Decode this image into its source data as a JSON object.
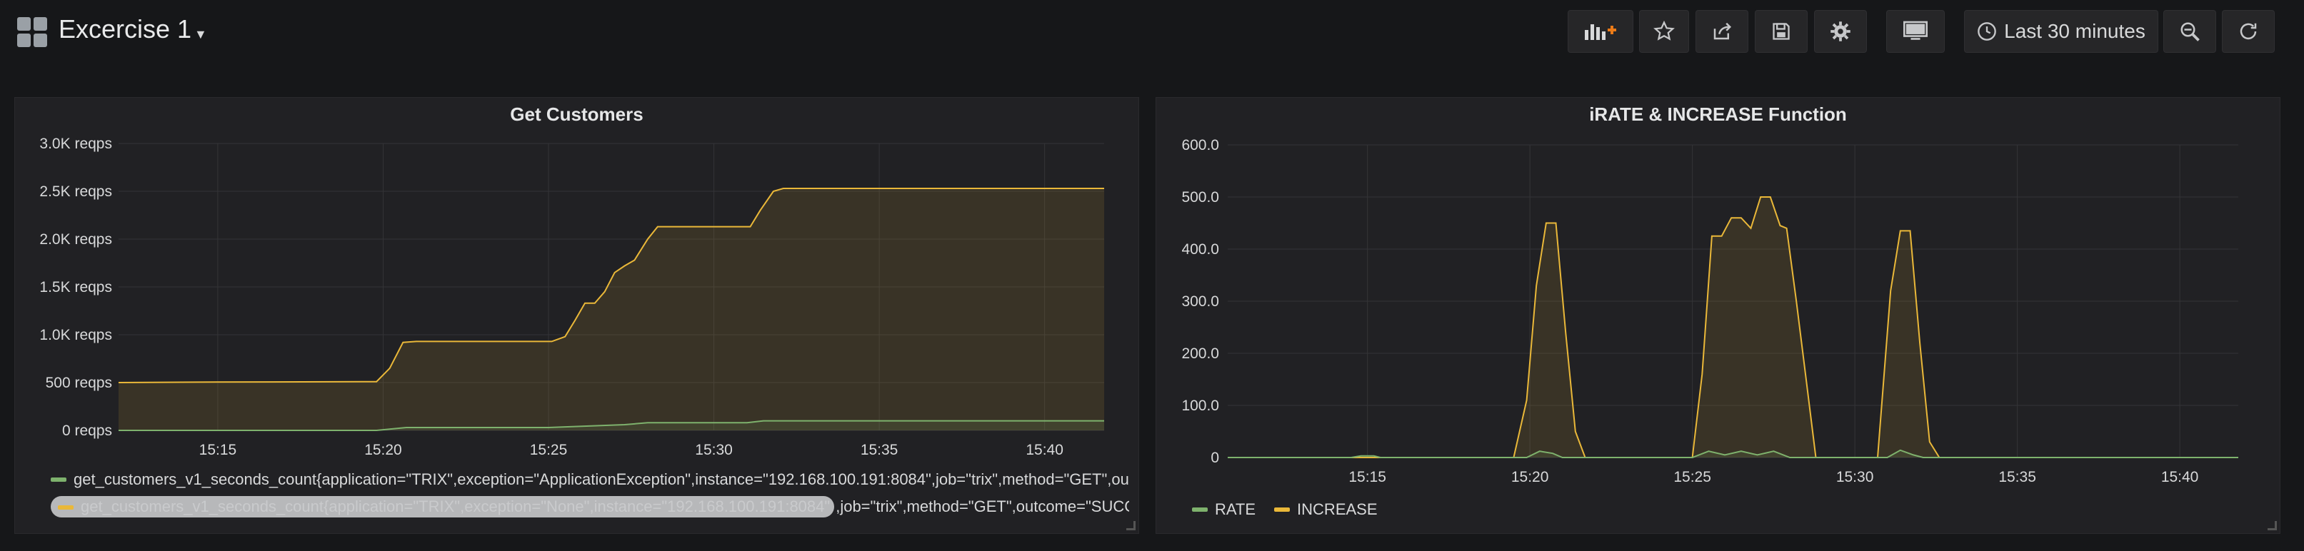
{
  "dashboard": {
    "title": "Excercise 1"
  },
  "toolbar": {
    "buttons": [
      {
        "name": "add-panel-button",
        "icon": "bar-chart-plus-icon"
      },
      {
        "name": "star-button",
        "icon": "star-icon"
      },
      {
        "name": "share-button",
        "icon": "share-icon"
      },
      {
        "name": "save-button",
        "icon": "save-icon"
      },
      {
        "name": "settings-button",
        "icon": "gear-icon"
      },
      {
        "name": "tv-mode-button",
        "icon": "monitor-icon"
      },
      {
        "name": "zoom-out-button",
        "icon": "zoom-out-icon"
      },
      {
        "name": "refresh-button",
        "icon": "refresh-icon"
      }
    ],
    "time_range_label": "Last 30 minutes"
  },
  "colors": {
    "green": "#7eb26d",
    "yellow": "#eab839",
    "background": "#161719",
    "panel": "#212124"
  },
  "panels": [
    {
      "title": "Get Customers",
      "legend": [
        {
          "text": "get_customers_v1_seconds_count{application=\"TRIX\",exception=\"ApplicationException\",instance=\"192.168.100.191:8084\",job=\"trix\",method=\"GET\",ou",
          "color": "#7eb26d"
        },
        {
          "text_selected": "get_customers_v1_seconds_count{application=\"TRIX\",exception=\"None\",instance=\"192.168.100.191:8084\"",
          "text_rest": ",job=\"trix\",method=\"GET\",outcome=\"SUCCE",
          "color": "#eab839"
        }
      ]
    },
    {
      "title": "iRATE & INCREASE Function",
      "legend": [
        {
          "text": "RATE",
          "color": "#7eb26d"
        },
        {
          "text": "INCREASE",
          "color": "#eab839"
        }
      ]
    }
  ],
  "chart_data": [
    {
      "type": "area",
      "title": "Get Customers",
      "x_ticks": [
        "15:15",
        "15:20",
        "15:25",
        "15:30",
        "15:35",
        "15:40"
      ],
      "y_ticks": [
        "0 reqps",
        "500 reqps",
        "1.0K reqps",
        "1.5K reqps",
        "2.0K reqps",
        "2.5K reqps",
        "3.0K reqps"
      ],
      "ylim": [
        0,
        3000
      ],
      "x_range_minutes": [
        12.0,
        41.8
      ],
      "grid": true,
      "legend_position": "bottom",
      "series": [
        {
          "color": "#eab839",
          "points": [
            [
              12.0,
              500
            ],
            [
              15.0,
              505
            ],
            [
              19.8,
              510
            ],
            [
              20.2,
              650
            ],
            [
              20.6,
              920
            ],
            [
              21.0,
              930
            ],
            [
              24.0,
              930
            ],
            [
              25.1,
              930
            ],
            [
              25.5,
              980
            ],
            [
              25.8,
              1150
            ],
            [
              26.1,
              1330
            ],
            [
              26.4,
              1330
            ],
            [
              26.7,
              1450
            ],
            [
              27.0,
              1650
            ],
            [
              27.3,
              1720
            ],
            [
              27.6,
              1780
            ],
            [
              28.0,
              2000
            ],
            [
              28.3,
              2130
            ],
            [
              29.0,
              2130
            ],
            [
              30.5,
              2130
            ],
            [
              31.1,
              2130
            ],
            [
              31.4,
              2300
            ],
            [
              31.8,
              2500
            ],
            [
              32.1,
              2530
            ],
            [
              35.0,
              2530
            ],
            [
              41.8,
              2530
            ]
          ]
        },
        {
          "color": "#7eb26d",
          "points": [
            [
              12.0,
              0
            ],
            [
              19.8,
              0
            ],
            [
              20.7,
              30
            ],
            [
              25.0,
              30
            ],
            [
              27.3,
              60
            ],
            [
              28.0,
              80
            ],
            [
              31.0,
              80
            ],
            [
              31.5,
              100
            ],
            [
              41.8,
              100
            ]
          ]
        }
      ]
    },
    {
      "type": "area",
      "title": "iRATE & INCREASE Function",
      "x_ticks": [
        "15:15",
        "15:20",
        "15:25",
        "15:30",
        "15:35",
        "15:40"
      ],
      "y_ticks": [
        "0",
        "100.0",
        "200.0",
        "300.0",
        "400.0",
        "500.0",
        "600.0"
      ],
      "ylim": [
        0,
        600
      ],
      "x_range_minutes": [
        10.7,
        41.8
      ],
      "grid": true,
      "legend_position": "bottom",
      "series": [
        {
          "name": "INCREASE",
          "color": "#eab839",
          "points": [
            [
              10.7,
              0
            ],
            [
              19.5,
              0
            ],
            [
              19.9,
              110
            ],
            [
              20.2,
              330
            ],
            [
              20.5,
              450
            ],
            [
              20.8,
              450
            ],
            [
              21.1,
              240
            ],
            [
              21.4,
              50
            ],
            [
              21.7,
              0
            ],
            [
              25.0,
              0
            ],
            [
              25.3,
              160
            ],
            [
              25.6,
              425
            ],
            [
              25.9,
              425
            ],
            [
              26.2,
              460
            ],
            [
              26.5,
              460
            ],
            [
              26.8,
              440
            ],
            [
              27.1,
              500
            ],
            [
              27.4,
              500
            ],
            [
              27.7,
              445
            ],
            [
              27.9,
              440
            ],
            [
              28.2,
              300
            ],
            [
              28.5,
              150
            ],
            [
              28.8,
              0
            ],
            [
              30.7,
              0
            ],
            [
              31.1,
              320
            ],
            [
              31.4,
              435
            ],
            [
              31.7,
              435
            ],
            [
              32.0,
              220
            ],
            [
              32.3,
              30
            ],
            [
              32.6,
              0
            ],
            [
              41.8,
              0
            ]
          ]
        },
        {
          "name": "RATE",
          "color": "#7eb26d",
          "points": [
            [
              10.7,
              0
            ],
            [
              14.5,
              0
            ],
            [
              14.8,
              3
            ],
            [
              15.2,
              3
            ],
            [
              15.4,
              0
            ],
            [
              19.9,
              0
            ],
            [
              20.3,
              12
            ],
            [
              20.7,
              8
            ],
            [
              21.0,
              0
            ],
            [
              25.0,
              0
            ],
            [
              25.5,
              12
            ],
            [
              26.0,
              5
            ],
            [
              26.5,
              12
            ],
            [
              27.0,
              5
            ],
            [
              27.5,
              12
            ],
            [
              28.0,
              0
            ],
            [
              31.0,
              0
            ],
            [
              31.4,
              14
            ],
            [
              31.8,
              5
            ],
            [
              32.1,
              0
            ],
            [
              41.8,
              0
            ]
          ]
        }
      ]
    }
  ]
}
